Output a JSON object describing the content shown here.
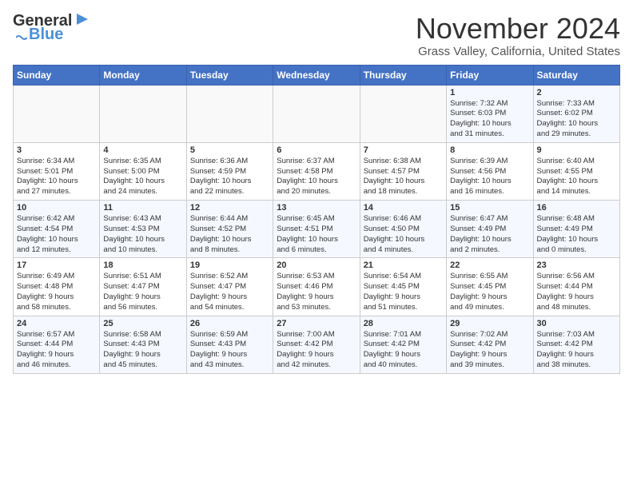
{
  "header": {
    "logo_line1": "General",
    "logo_line2": "Blue",
    "month": "November 2024",
    "location": "Grass Valley, California, United States"
  },
  "weekdays": [
    "Sunday",
    "Monday",
    "Tuesday",
    "Wednesday",
    "Thursday",
    "Friday",
    "Saturday"
  ],
  "weeks": [
    [
      {
        "day": "",
        "info": ""
      },
      {
        "day": "",
        "info": ""
      },
      {
        "day": "",
        "info": ""
      },
      {
        "day": "",
        "info": ""
      },
      {
        "day": "",
        "info": ""
      },
      {
        "day": "1",
        "info": "Sunrise: 7:32 AM\nSunset: 6:03 PM\nDaylight: 10 hours\nand 31 minutes."
      },
      {
        "day": "2",
        "info": "Sunrise: 7:33 AM\nSunset: 6:02 PM\nDaylight: 10 hours\nand 29 minutes."
      }
    ],
    [
      {
        "day": "3",
        "info": "Sunrise: 6:34 AM\nSunset: 5:01 PM\nDaylight: 10 hours\nand 27 minutes."
      },
      {
        "day": "4",
        "info": "Sunrise: 6:35 AM\nSunset: 5:00 PM\nDaylight: 10 hours\nand 24 minutes."
      },
      {
        "day": "5",
        "info": "Sunrise: 6:36 AM\nSunset: 4:59 PM\nDaylight: 10 hours\nand 22 minutes."
      },
      {
        "day": "6",
        "info": "Sunrise: 6:37 AM\nSunset: 4:58 PM\nDaylight: 10 hours\nand 20 minutes."
      },
      {
        "day": "7",
        "info": "Sunrise: 6:38 AM\nSunset: 4:57 PM\nDaylight: 10 hours\nand 18 minutes."
      },
      {
        "day": "8",
        "info": "Sunrise: 6:39 AM\nSunset: 4:56 PM\nDaylight: 10 hours\nand 16 minutes."
      },
      {
        "day": "9",
        "info": "Sunrise: 6:40 AM\nSunset: 4:55 PM\nDaylight: 10 hours\nand 14 minutes."
      }
    ],
    [
      {
        "day": "10",
        "info": "Sunrise: 6:42 AM\nSunset: 4:54 PM\nDaylight: 10 hours\nand 12 minutes."
      },
      {
        "day": "11",
        "info": "Sunrise: 6:43 AM\nSunset: 4:53 PM\nDaylight: 10 hours\nand 10 minutes."
      },
      {
        "day": "12",
        "info": "Sunrise: 6:44 AM\nSunset: 4:52 PM\nDaylight: 10 hours\nand 8 minutes."
      },
      {
        "day": "13",
        "info": "Sunrise: 6:45 AM\nSunset: 4:51 PM\nDaylight: 10 hours\nand 6 minutes."
      },
      {
        "day": "14",
        "info": "Sunrise: 6:46 AM\nSunset: 4:50 PM\nDaylight: 10 hours\nand 4 minutes."
      },
      {
        "day": "15",
        "info": "Sunrise: 6:47 AM\nSunset: 4:49 PM\nDaylight: 10 hours\nand 2 minutes."
      },
      {
        "day": "16",
        "info": "Sunrise: 6:48 AM\nSunset: 4:49 PM\nDaylight: 10 hours\nand 0 minutes."
      }
    ],
    [
      {
        "day": "17",
        "info": "Sunrise: 6:49 AM\nSunset: 4:48 PM\nDaylight: 9 hours\nand 58 minutes."
      },
      {
        "day": "18",
        "info": "Sunrise: 6:51 AM\nSunset: 4:47 PM\nDaylight: 9 hours\nand 56 minutes."
      },
      {
        "day": "19",
        "info": "Sunrise: 6:52 AM\nSunset: 4:47 PM\nDaylight: 9 hours\nand 54 minutes."
      },
      {
        "day": "20",
        "info": "Sunrise: 6:53 AM\nSunset: 4:46 PM\nDaylight: 9 hours\nand 53 minutes."
      },
      {
        "day": "21",
        "info": "Sunrise: 6:54 AM\nSunset: 4:45 PM\nDaylight: 9 hours\nand 51 minutes."
      },
      {
        "day": "22",
        "info": "Sunrise: 6:55 AM\nSunset: 4:45 PM\nDaylight: 9 hours\nand 49 minutes."
      },
      {
        "day": "23",
        "info": "Sunrise: 6:56 AM\nSunset: 4:44 PM\nDaylight: 9 hours\nand 48 minutes."
      }
    ],
    [
      {
        "day": "24",
        "info": "Sunrise: 6:57 AM\nSunset: 4:44 PM\nDaylight: 9 hours\nand 46 minutes."
      },
      {
        "day": "25",
        "info": "Sunrise: 6:58 AM\nSunset: 4:43 PM\nDaylight: 9 hours\nand 45 minutes."
      },
      {
        "day": "26",
        "info": "Sunrise: 6:59 AM\nSunset: 4:43 PM\nDaylight: 9 hours\nand 43 minutes."
      },
      {
        "day": "27",
        "info": "Sunrise: 7:00 AM\nSunset: 4:42 PM\nDaylight: 9 hours\nand 42 minutes."
      },
      {
        "day": "28",
        "info": "Sunrise: 7:01 AM\nSunset: 4:42 PM\nDaylight: 9 hours\nand 40 minutes."
      },
      {
        "day": "29",
        "info": "Sunrise: 7:02 AM\nSunset: 4:42 PM\nDaylight: 9 hours\nand 39 minutes."
      },
      {
        "day": "30",
        "info": "Sunrise: 7:03 AM\nSunset: 4:42 PM\nDaylight: 9 hours\nand 38 minutes."
      }
    ]
  ]
}
